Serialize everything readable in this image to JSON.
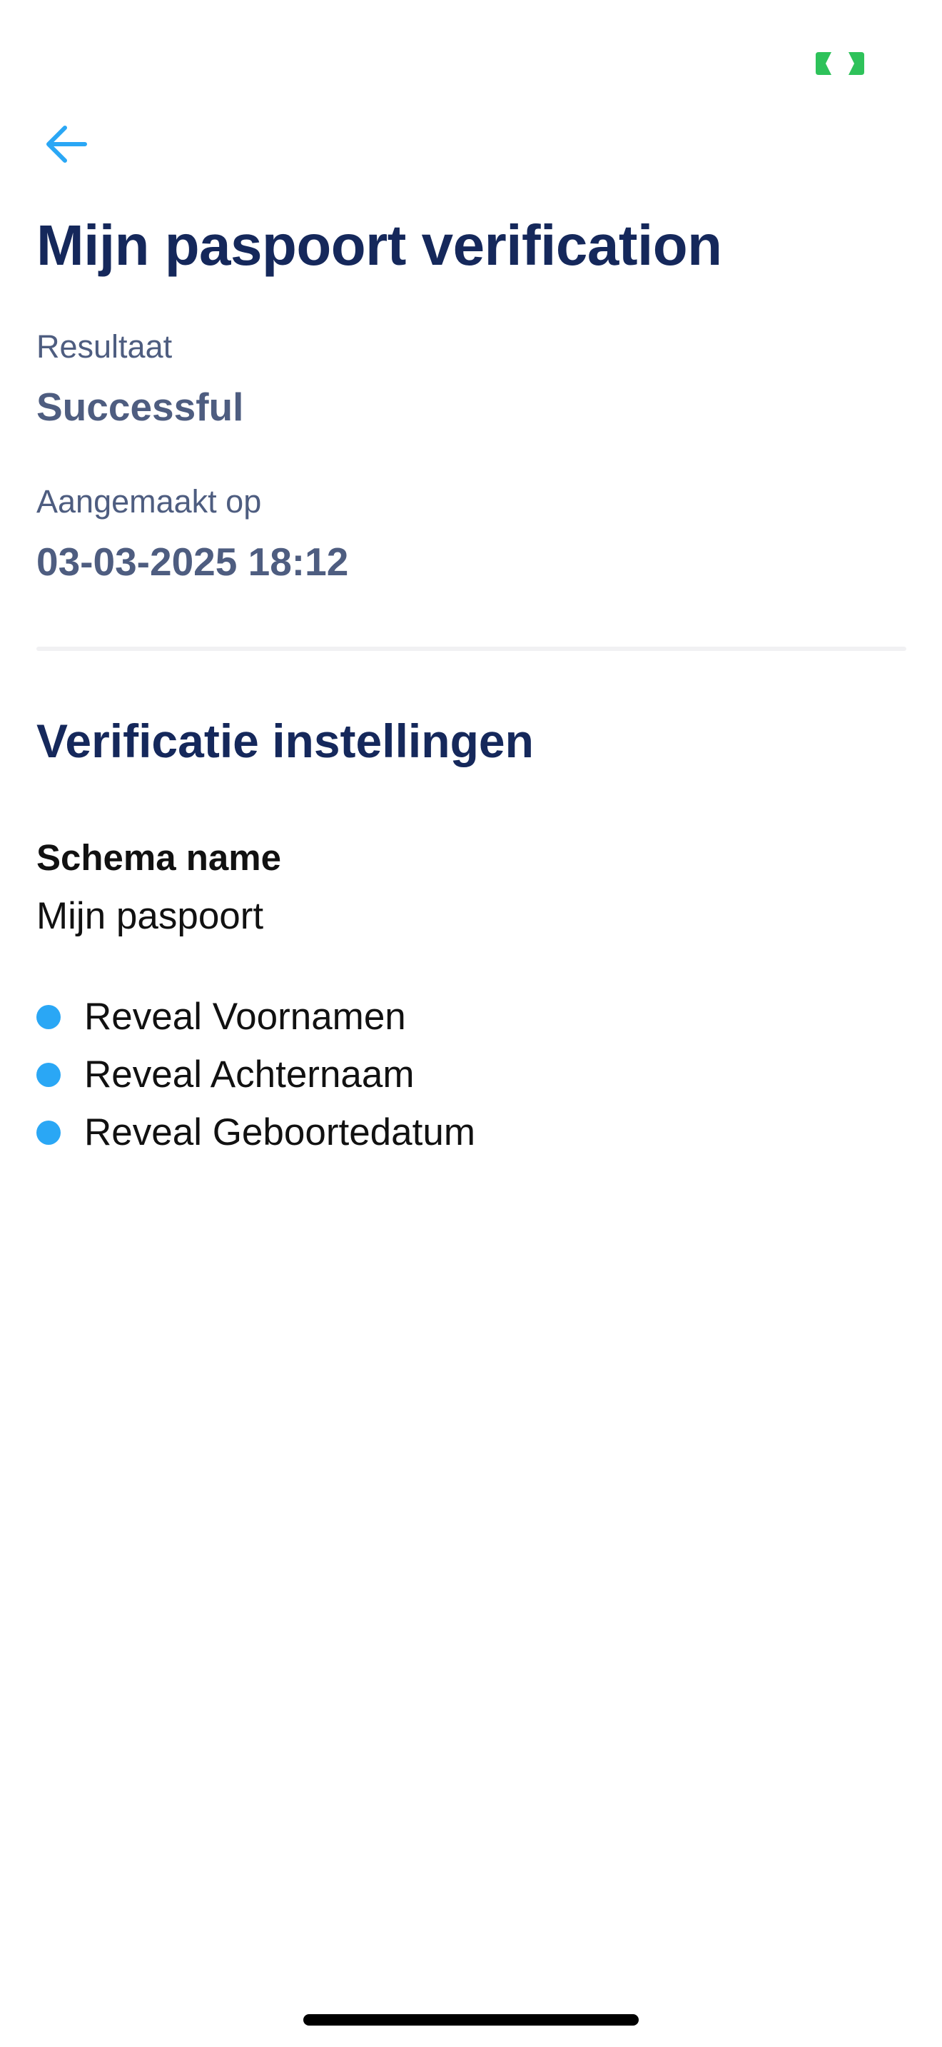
{
  "status_bar": {
    "indicator_icon": "camera-in-use-indicator",
    "indicator_color": "#2ec25a"
  },
  "header": {
    "back_icon": "arrow-left-icon",
    "back_color": "#2aa7f5",
    "title": "Mijn paspoort verification",
    "title_color": "#15285b"
  },
  "details": {
    "result_label": "Resultaat",
    "result_value": "Successful",
    "created_label": "Aangemaakt op",
    "created_value": "03-03-2025 18:12"
  },
  "settings": {
    "section_title": "Verificatie instellingen",
    "schema_label": "Schema name",
    "schema_value": "Mijn paspoort",
    "bullet_color": "#2aa7f5",
    "reveals": [
      "Reveal Voornamen",
      "Reveal Achternaam",
      "Reveal Geboortedatum"
    ]
  }
}
